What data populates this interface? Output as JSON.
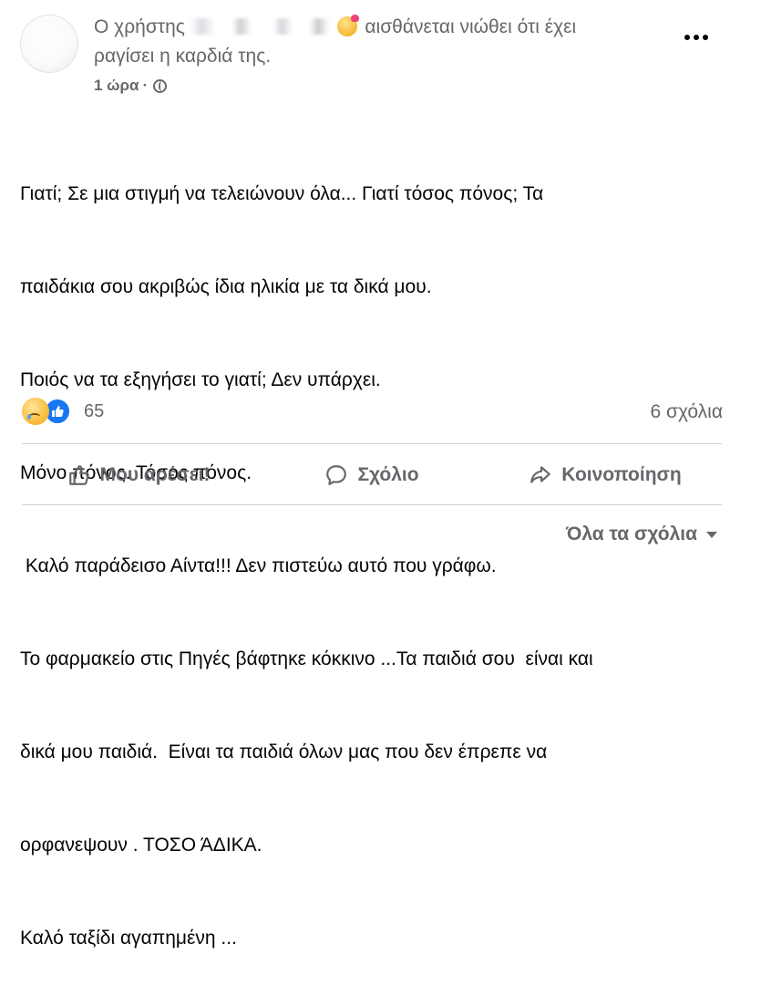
{
  "post": {
    "header_prefix": "Ο χρήστης",
    "header_suffix": "αισθάνεται νιώθει ότι έχει",
    "header_line2": "ραγίσει η καρδιά της.",
    "time": "1 ώρα",
    "separator": "·",
    "body_lines": [
      "Γιατί; Σε μια στιγμή να τελειώνουν όλα... Γιατί τόσος πόνος; Τα",
      "παιδάκια σου ακριβώς ίδια ηλικία με τα δικά μου.",
      "Ποιός να τα εξηγήσει το γιατί; Δεν υπάρχει.",
      "Μόνο πόνος. Τόσος πόνος.",
      " Καλό παράδεισο Αίντα!!! Δεν πιστεύω αυτό που γράφω.",
      "Το φαρμακείο στις Πηγές βάφτηκε κόκκινο ...Τα παιδιά σου  είναι και",
      "δικά μου παιδιά.  Είναι τα παιδιά όλων μας που δεν έπρεπε να",
      "ορφανεψουν . ΤΟΣΟ ΆΔΙΚΑ.",
      "Καλό ταξίδι αγαπημένη ..."
    ],
    "reaction_count": "65",
    "comments_count": "6 σχόλια"
  },
  "actions": {
    "like": "Μου αρέσει!",
    "comment": "Σχόλιο",
    "share": "Κοινοποίηση"
  },
  "comments_sort": "Όλα τα σχόλια",
  "icons": {
    "reaction_1": "sad-reaction-icon",
    "reaction_2": "like-reaction-icon",
    "feeling": "heartbroken-emoji-icon",
    "privacy": "globe-icon"
  }
}
